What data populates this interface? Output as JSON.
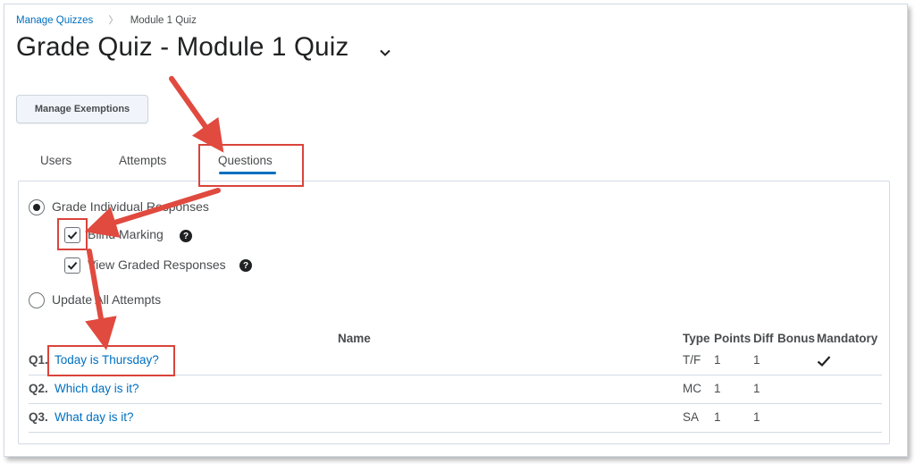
{
  "breadcrumb": {
    "link": "Manage Quizzes",
    "current": "Module 1 Quiz"
  },
  "page": {
    "title": "Grade Quiz - Module 1 Quiz"
  },
  "actions": {
    "manage_exemptions": "Manage Exemptions"
  },
  "tabs": [
    {
      "label": "Users"
    },
    {
      "label": "Attempts"
    },
    {
      "label": "Questions",
      "selected": true
    }
  ],
  "options": {
    "grade_individual": {
      "label": "Grade Individual Responses",
      "selected": true
    },
    "blind_marking": {
      "label": "Blind Marking",
      "checked": true
    },
    "view_graded": {
      "label": "View Graded Responses",
      "checked": true
    },
    "update_all": {
      "label": "Update All Attempts",
      "selected": false
    }
  },
  "table": {
    "headers": {
      "name": "Name",
      "type": "Type",
      "points": "Points",
      "diff": "Diff",
      "bonus": "Bonus",
      "mandatory": "Mandatory"
    },
    "rows": [
      {
        "num": "Q1.",
        "name": "Today is Thursday?",
        "type": "T/F",
        "points": "1",
        "diff": "1",
        "mandatory": true
      },
      {
        "num": "Q2.",
        "name": "Which day is it?",
        "type": "MC",
        "points": "1",
        "diff": "1",
        "mandatory": false
      },
      {
        "num": "Q3.",
        "name": "What day is it?",
        "type": "SA",
        "points": "1",
        "diff": "1",
        "mandatory": false
      }
    ]
  },
  "colors": {
    "link": "#006fbf",
    "annotation": "#d9443b",
    "tab_underline": "#006fbf"
  },
  "icons": [
    "chevron-down-icon",
    "help-icon",
    "checkmark-icon",
    "annotation-arrow"
  ]
}
